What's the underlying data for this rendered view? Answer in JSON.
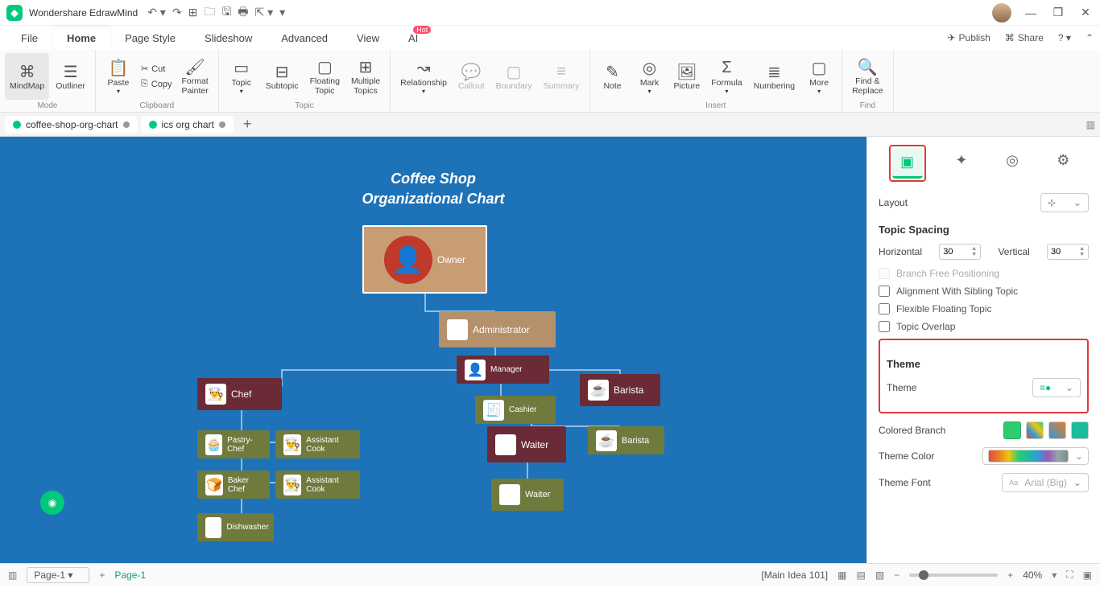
{
  "app": {
    "title": "Wondershare EdrawMind"
  },
  "menu": {
    "items": [
      "File",
      "Home",
      "Page Style",
      "Slideshow",
      "Advanced",
      "View",
      "AI"
    ],
    "active": "Home",
    "hot_index": 6,
    "publish": "Publish",
    "share": "Share"
  },
  "ribbon": {
    "mode_group": "Mode",
    "mindmap": "MindMap",
    "outliner": "Outliner",
    "clipboard_group": "Clipboard",
    "paste": "Paste",
    "cut": "Cut",
    "copy": "Copy",
    "format_painter": "Format\nPainter",
    "topic_group": "Topic",
    "topic": "Topic",
    "subtopic": "Subtopic",
    "floating": "Floating\nTopic",
    "multiple": "Multiple\nTopics",
    "relationship": "Relationship",
    "callout": "Callout",
    "boundary": "Boundary",
    "summary": "Summary",
    "insert_group": "Insert",
    "note": "Note",
    "mark": "Mark",
    "picture": "Picture",
    "formula": "Formula",
    "numbering": "Numbering",
    "more": "More",
    "find_group": "Find",
    "find": "Find &\nReplace"
  },
  "tabs": {
    "t1": "coffee-shop-org-chart",
    "t2": "ics org chart"
  },
  "side_panel_tab": "tabs-right-icon",
  "chart": {
    "title_l1": "Coffee Shop",
    "title_l2": "Organizational Chart",
    "owner": "Owner",
    "admin": "Administrator",
    "manager": "Manager",
    "cashier": "Cashier",
    "chef": "Chef",
    "barista": "Barista",
    "waiter": "Waiter",
    "pastry": "Pastry-Chef",
    "acook": "Assistant Cook",
    "baker": "Baker Chef",
    "dish": "Dishwasher"
  },
  "panel": {
    "layout": "Layout",
    "topic_spacing": "Topic Spacing",
    "horizontal": "Horizontal",
    "h_val": "30",
    "vertical": "Vertical",
    "v_val": "30",
    "branch_free": "Branch Free Positioning",
    "align_sibling": "Alignment With Sibling Topic",
    "flex_float": "Flexible Floating Topic",
    "overlap": "Topic Overlap",
    "theme": "Theme",
    "colored_branch": "Colored Branch",
    "theme_color": "Theme Color",
    "theme_font": "Theme Font",
    "font_val": "Arial (Big)"
  },
  "status": {
    "page_dd": "Page-1",
    "page_link": "Page-1",
    "main_idea": "[Main Idea 101]",
    "zoom": "40%"
  }
}
